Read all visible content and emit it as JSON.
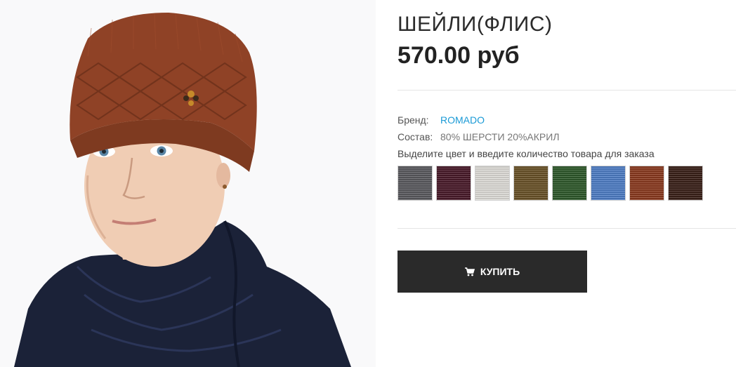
{
  "product": {
    "title": "ШЕЙЛИ(ФЛИС)",
    "price": "570.00 руб"
  },
  "details": {
    "brand_label": "Бренд:",
    "brand_value": "ROMADO",
    "composition_label": "Состав:",
    "composition_value": "80% ШЕРСТИ 20%АКРИЛ"
  },
  "color_hint": "Выделите цвет и введите количество товара для заказа",
  "swatches": [
    {
      "color": "#5b5b60"
    },
    {
      "color": "#4a1a2a"
    },
    {
      "color": "#e2e0dc"
    },
    {
      "color": "#6b5328"
    },
    {
      "color": "#2f5a2b"
    },
    {
      "color": "#4f7fc8"
    },
    {
      "color": "#8c3a1f"
    },
    {
      "color": "#3a2018"
    }
  ],
  "buy_button": {
    "label": "КУПИТЬ",
    "icon": "cart-icon"
  },
  "colors": {
    "brand_link": "#1a9ad6",
    "button_bg": "#2a2a2a",
    "hat": "#8f4226",
    "jacket": "#1b2238"
  }
}
